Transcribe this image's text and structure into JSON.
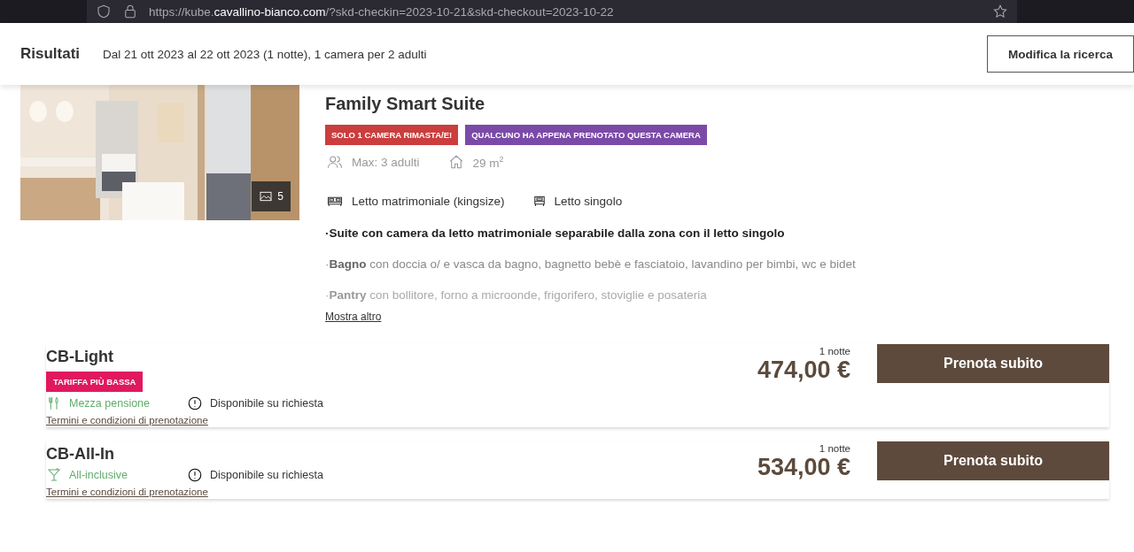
{
  "browser": {
    "url_prefix": "https://kube.",
    "url_domain": "cavallino-bianco.com",
    "url_rest": "/?skd-checkin=2023-10-21&skd-checkout=2023-10-22"
  },
  "header": {
    "title": "Risultati",
    "summary": "Dal 21 ott 2023 al 22 ott 2023 (1 notte), 1 camera per 2 adulti",
    "button": "Modifica la ricerca"
  },
  "room": {
    "title": "Family Smart Suite",
    "photo": {
      "kind": "picture",
      "count": "5"
    },
    "badges": [
      {
        "label": "SOLO 1 CAMERA RIMASTA/E!",
        "color": "#cc3d3d"
      },
      {
        "label": "QUALCUNO HA APPENA PRENOTATO QUESTA CAMERA",
        "color": "#7b4aa8"
      }
    ],
    "capacity": "Max: 3 adulti",
    "size": "29 m$^{2}$",
    "beds": [
      {
        "kind": "double",
        "label": "Letto matrimoniale (kingsize)"
      },
      {
        "kind": "single",
        "label": "Letto singolo"
      }
    ],
    "description": [
      {
        "text": "·Suite con camera da letto matrimoniale separabile dalla zona con il letto singolo",
        "emphasis": true
      },
      {
        "text": "·**Bagno** con doccia o/ e vasca da bagno, bagnetto bebè e fasciatoio, lavandino per bimbi, wc e bidet",
        "emphasis": false
      },
      {
        "text": "·**Pantry** con bollitore, forno a microonde, frigorifero, stoviglie e posateria",
        "emphasis": false
      }
    ],
    "more_link": "Mostra altro"
  },
  "rates": [
    {
      "name": "CB-Light",
      "tag": "TARIFFA PIÙ BASSA",
      "kind": "meal",
      "board": "Mezza pensione",
      "availability": "Disponibile su richiesta",
      "terms": "Termini e condizioni di prenotazione",
      "nights": "1 notte",
      "price": "474,00 €",
      "button": "Prenota subito"
    },
    {
      "name": "CB-All-In",
      "kind": "drink",
      "board": "All-inclusive",
      "availability": "Disponibile su richiesta",
      "terms": "Termini e condizioni di prenotazione",
      "nights": "1 notte",
      "price": "534,00 €",
      "button": "Prenota subito"
    }
  ]
}
